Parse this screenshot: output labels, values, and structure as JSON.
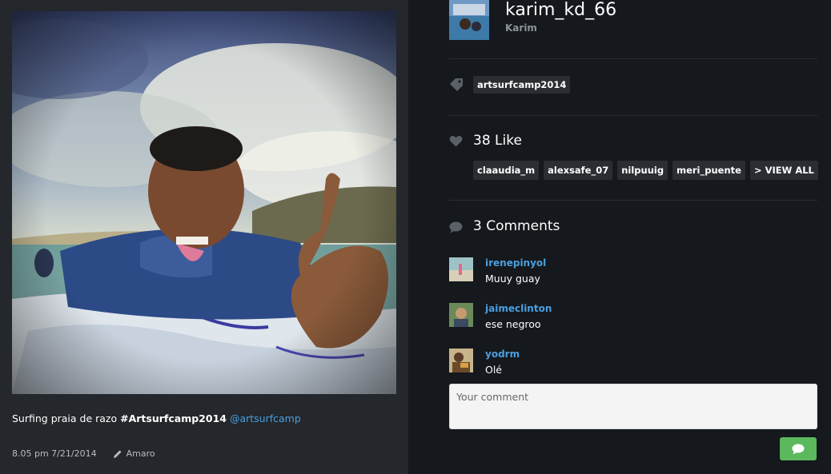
{
  "post": {
    "caption_text": "Surfing praia de razo ",
    "caption_hashtag": "#Artsurfcamp2014",
    "caption_mention": "@artsurfcamp",
    "timestamp": "8.05 pm 7/21/2014",
    "filter": "Amaro"
  },
  "user": {
    "username": "karim_kd_66",
    "full_name": "Karim"
  },
  "tags": {
    "icon": "tag-icon",
    "items": [
      "artsurfcamp2014"
    ]
  },
  "likes": {
    "icon": "heart-icon",
    "title": "38 Like",
    "users": [
      "claaudia_m",
      "alexsafe_07",
      "nilpuuig",
      "meri_puente"
    ],
    "view_all": "> VIEW ALL"
  },
  "comments": {
    "icon": "speech-bubble-icon",
    "title": "3 Comments",
    "items": [
      {
        "user": "irenepinyol",
        "text": "Muuy guay"
      },
      {
        "user": "jaimeclinton",
        "text": "ese negroo"
      },
      {
        "user": "yodrm",
        "text": "Olé"
      }
    ],
    "input_placeholder": "Your comment",
    "submit_icon": "speech-bubble-icon"
  },
  "colors": {
    "link": "#4a9fe0",
    "submit": "#5cb85c",
    "pill_bg": "#2a2e33"
  }
}
